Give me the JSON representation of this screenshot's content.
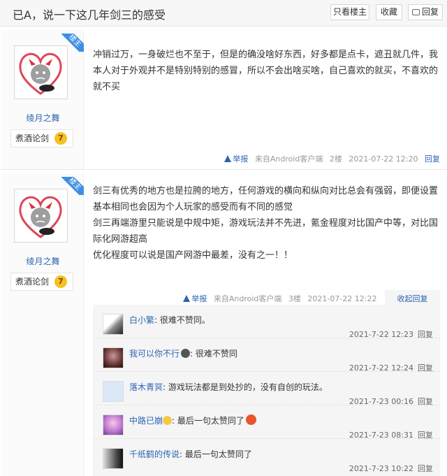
{
  "header": {
    "title": "已A，说一下这几年剑三的感受",
    "btn_only_op": "只看楼主",
    "btn_favorite": "收藏",
    "btn_reply": "回复"
  },
  "posts": [
    {
      "badge": "楼主",
      "username": "绫月之舞",
      "level_name": "煮酒论剑",
      "level": "7",
      "text": "冲销过万，一身破烂也不至于，但是的确没啥好东西，好多都是点卡，遮丑就几件，我本人对于外观并不是特别特别的感冒，所以不会出啥买啥，自己喜欢的就买，不喜欢的就不买",
      "report": "举报",
      "source": "来自Android客户端",
      "floor": "2楼",
      "time": "2021-07-22 12:20",
      "reply": "回复"
    },
    {
      "badge": "楼主",
      "username": "绫月之舞",
      "level_name": "煮酒论剑",
      "level": "7",
      "text": "剑三有优秀的地方也是拉胯的地方，任何游戏的横向和纵向对比总会有强弱，即便设置基本相同也会因为个人玩家的感受而有不同的感觉\n剑三再端游里只能说是中规中矩，游戏玩法并不先进，氪金程度对比国产中等，对比国际化网游超高\n优化程度可以说是国产网游中最差，没有之一！！",
      "report": "举报",
      "source": "来自Android客户端",
      "floor": "3楼",
      "time": "2021-07-22 12:22",
      "collapse": "收起回复"
    }
  ],
  "sub_replies": [
    {
      "user": "白小繁",
      "text": ": 很难不赞同。",
      "time": "2021-7-22 12:23",
      "reply": "回复"
    },
    {
      "user": "我可以你不行",
      "text": ": 很难不赞同",
      "time": "2021-7-22 12:24",
      "reply": "回复"
    },
    {
      "user": "落木青冥",
      "text": ": 游戏玩法都是到处抄的，没有自创的玩法。",
      "time": "2021-7-23 00:16",
      "reply": "回复"
    },
    {
      "user": "中路已崩",
      "text": ": 最后一句太赞同了",
      "time": "2021-7-23 08:31",
      "reply": "回复"
    },
    {
      "user": "千纸鹤的传说",
      "text": ": 最后一句太赞同了",
      "time": "2021-7-23 10:22",
      "reply": "回复"
    }
  ],
  "colors": {
    "link": "#2d64b3",
    "badge": "#3e8fe3",
    "level": "#f5c024"
  },
  "icons": [
    "avatar-devil-heart",
    "warning-icon",
    "reply-icon",
    "emoji-icon"
  ]
}
